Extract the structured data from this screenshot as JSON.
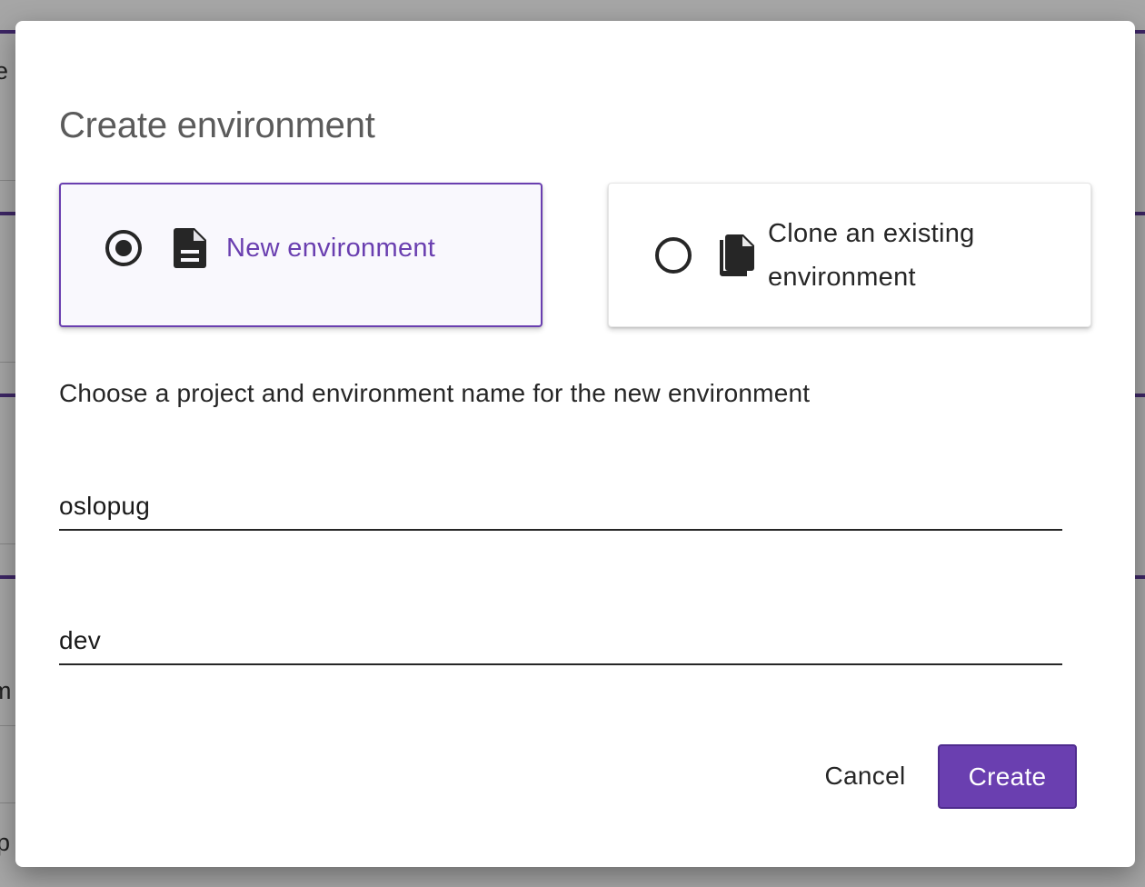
{
  "dialog": {
    "title": "Create environment",
    "options": [
      {
        "label": "New environment",
        "icon": "document-icon",
        "selected": true
      },
      {
        "label": "Clone an existing environment",
        "label_line1": "Clone an existing",
        "label_line2": "environment",
        "icon": "copy-documents-icon",
        "selected": false
      }
    ],
    "instructions": "Choose a project and environment name for the new environment",
    "fields": {
      "project": {
        "value": "oslopug"
      },
      "environment": {
        "value": "dev"
      }
    },
    "actions": {
      "cancel_label": "Cancel",
      "create_label": "Create"
    }
  },
  "background": {
    "partial_texts": [
      "e",
      "m",
      "p"
    ]
  },
  "colors": {
    "accent": "#6a3fb0",
    "selected_card_bg": "#f9f8fd",
    "text": "#262626",
    "title": "#5b5b5b"
  }
}
